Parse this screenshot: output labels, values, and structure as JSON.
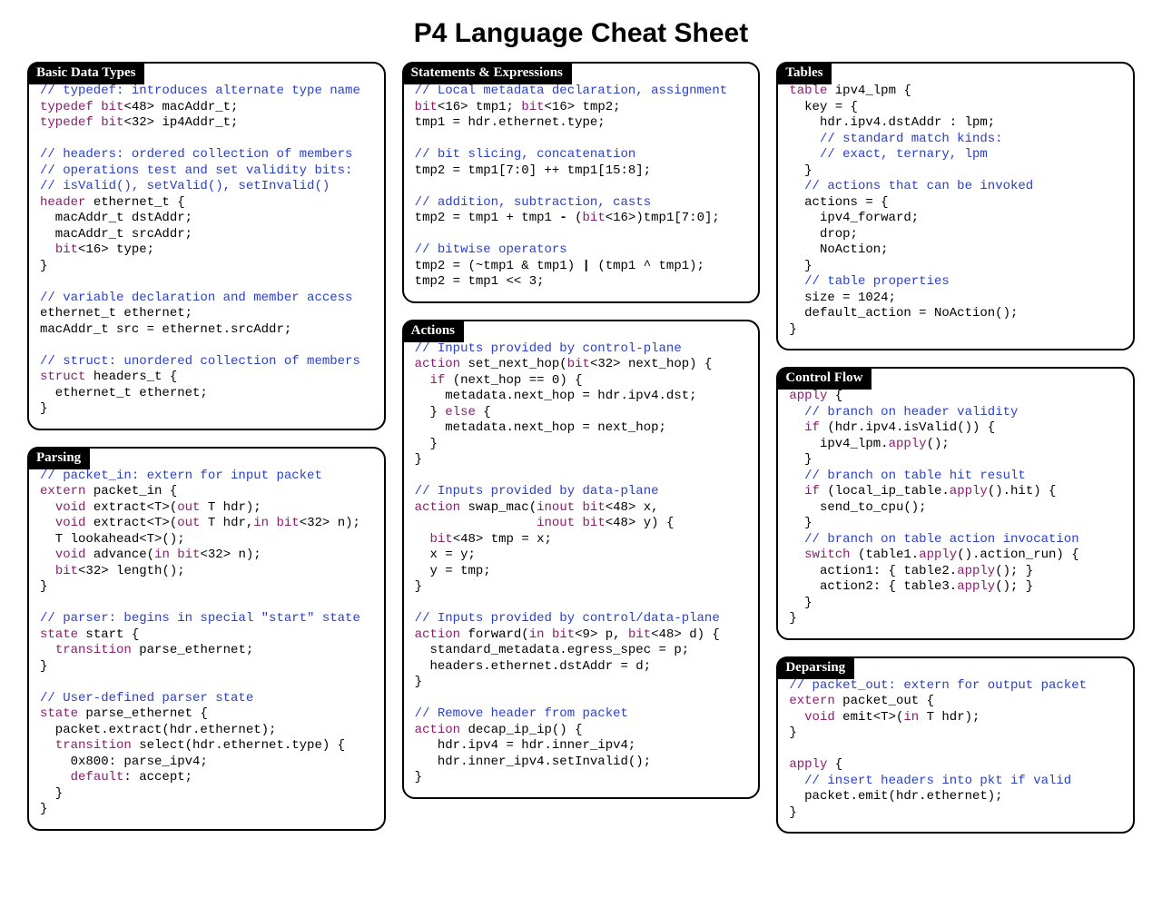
{
  "title": "P4 Language Cheat Sheet",
  "boxes": {
    "basic": {
      "title": "Basic Data Types",
      "code": "<span class=\"c\">// typedef: introduces alternate type name</span>\n<span class=\"k\">typedef</span> <span class=\"k\">bit</span>&lt;48&gt; macAddr_t;\n<span class=\"k\">typedef</span> <span class=\"k\">bit</span>&lt;32&gt; ip4Addr_t;\n\n<span class=\"c\">// headers: ordered collection of members</span>\n<span class=\"c\">// operations test and set validity bits:</span>\n<span class=\"c\">// isValid(), setValid(), setInvalid()</span>\n<span class=\"k\">header</span> ethernet_t {\n  macAddr_t dstAddr;\n  macAddr_t srcAddr;\n  <span class=\"k\">bit</span>&lt;16&gt; type;\n}\n\n<span class=\"c\">// variable declaration and member access</span>\nethernet_t ethernet;\nmacAddr_t src = ethernet.srcAddr;\n\n<span class=\"c\">// struct: unordered collection of members</span>\n<span class=\"k\">struct</span> headers_t {\n  ethernet_t ethernet;\n}"
    },
    "parsing": {
      "title": "Parsing",
      "code": "<span class=\"c\">// packet_in: extern for input packet</span>\n<span class=\"k\">extern</span> packet_in {\n  <span class=\"k\">void</span> extract&lt;T&gt;(<span class=\"k\">out</span> T hdr);\n  <span class=\"k\">void</span> extract&lt;T&gt;(<span class=\"k\">out</span> T hdr,<span class=\"k\">in</span> <span class=\"k\">bit</span>&lt;32&gt; n);\n  T lookahead&lt;T&gt;();\n  <span class=\"k\">void</span> advance(<span class=\"k\">in</span> <span class=\"k\">bit</span>&lt;32&gt; n);\n  <span class=\"k\">bit</span>&lt;32&gt; length();\n}\n\n<span class=\"c\">// parser: begins in special \"start\" state</span>\n<span class=\"k\">state</span> start {\n  <span class=\"k\">transition</span> parse_ethernet;\n}\n\n<span class=\"c\">// User-defined parser state</span>\n<span class=\"k\">state</span> parse_ethernet {\n  packet.extract(hdr.ethernet);\n  <span class=\"k\">transition</span> select(hdr.ethernet.type) {\n    0x800: parse_ipv4;\n    <span class=\"k\">default</span>: accept;\n  }\n}"
    },
    "statements": {
      "title": "Statements & Expressions",
      "code": "<span class=\"c\">// Local metadata declaration, assignment</span>\n<span class=\"k\">bit</span>&lt;16&gt; tmp1; <span class=\"k\">bit</span>&lt;16&gt; tmp2;\ntmp1 = hdr.ethernet.type;\n\n<span class=\"c\">// bit slicing, concatenation</span>\ntmp2 = tmp1[7:0] ++ tmp1[15:8];\n\n<span class=\"c\">// addition, subtraction, casts</span>\ntmp2 = tmp1 + tmp1 <b>-</b> (<span class=\"k\">bit</span>&lt;16&gt;)tmp1[7:0];\n\n<span class=\"c\">// bitwise operators</span>\ntmp2 = (~tmp1 &amp; tmp1) <b>|</b> (tmp1 ^ tmp1);\ntmp2 = tmp1 &lt;&lt; 3;"
    },
    "actions": {
      "title": "Actions",
      "code": "<span class=\"c\">// Inputs provided by control-plane</span>\n<span class=\"k\">action</span> set_next_hop(<span class=\"k\">bit</span>&lt;32&gt; next_hop) {\n  <span class=\"k\">if</span> (next_hop == 0) {\n    metadata.next_hop = hdr.ipv4.dst;\n  } <span class=\"k\">else</span> {\n    metadata.next_hop = next_hop;\n  }\n}\n\n<span class=\"c\">// Inputs provided by data-plane</span>\n<span class=\"k\">action</span> swap_mac(<span class=\"k\">inout</span> <span class=\"k\">bit</span>&lt;48&gt; x,\n                <span class=\"k\">inout</span> <span class=\"k\">bit</span>&lt;48&gt; y) {\n  <span class=\"k\">bit</span>&lt;48&gt; tmp = x;\n  x = y;\n  y = tmp;\n}\n\n<span class=\"c\">// Inputs provided by control/data-plane</span>\n<span class=\"k\">action</span> forward(<span class=\"k\">in</span> <span class=\"k\">bit</span>&lt;9&gt; p, <span class=\"k\">bit</span>&lt;48&gt; d) {\n  standard_metadata.egress_spec = p;\n  headers.ethernet.dstAddr = d;\n}\n\n<span class=\"c\">// Remove header from packet</span>\n<span class=\"k\">action</span> decap_ip_ip() {\n   hdr.ipv4 = hdr.inner_ipv4;\n   hdr.inner_ipv4.setInvalid();\n}"
    },
    "tables": {
      "title": "Tables",
      "code": "<span class=\"k\">table</span> ipv4_lpm {\n  key = {\n    hdr.ipv4.dstAddr : lpm;\n    <span class=\"c\">// standard match kinds:</span>\n    <span class=\"c\">// exact, ternary, lpm</span>\n  }\n  <span class=\"c\">// actions that can be invoked</span>\n  actions = {\n    ipv4_forward;\n    drop;\n    NoAction;\n  }\n  <span class=\"c\">// table properties</span>\n  size = 1024;\n  default_action = NoAction();\n}"
    },
    "controlflow": {
      "title": "Control Flow",
      "code": "<span class=\"k\">apply</span> {\n  <span class=\"c\">// branch on header validity</span>\n  <span class=\"k\">if</span> (hdr.ipv4.isValid()) {\n    ipv4_lpm.<span class=\"k\">apply</span>();\n  }\n  <span class=\"c\">// branch on table hit result</span>\n  <span class=\"k\">if</span> (local_ip_table.<span class=\"k\">apply</span>().hit) {\n    send_to_cpu();\n  }\n  <span class=\"c\">// branch on table action invocation</span>\n  <span class=\"k\">switch</span> (table1.<span class=\"k\">apply</span>().action_run) {\n    action1: { table2.<span class=\"k\">apply</span>(); }\n    action2: { table3.<span class=\"k\">apply</span>(); }\n  }\n}"
    },
    "deparsing": {
      "title": "Deparsing",
      "code": "<span class=\"c\">// packet_out: extern for output packet</span>\n<span class=\"k\">extern</span> packet_out {\n  <span class=\"k\">void</span> emit&lt;T&gt;(<span class=\"k\">in</span> T hdr);\n}\n\n<span class=\"k\">apply</span> {\n  <span class=\"c\">// insert headers into pkt if valid</span>\n  packet.emit(hdr.ethernet);\n}"
    }
  }
}
